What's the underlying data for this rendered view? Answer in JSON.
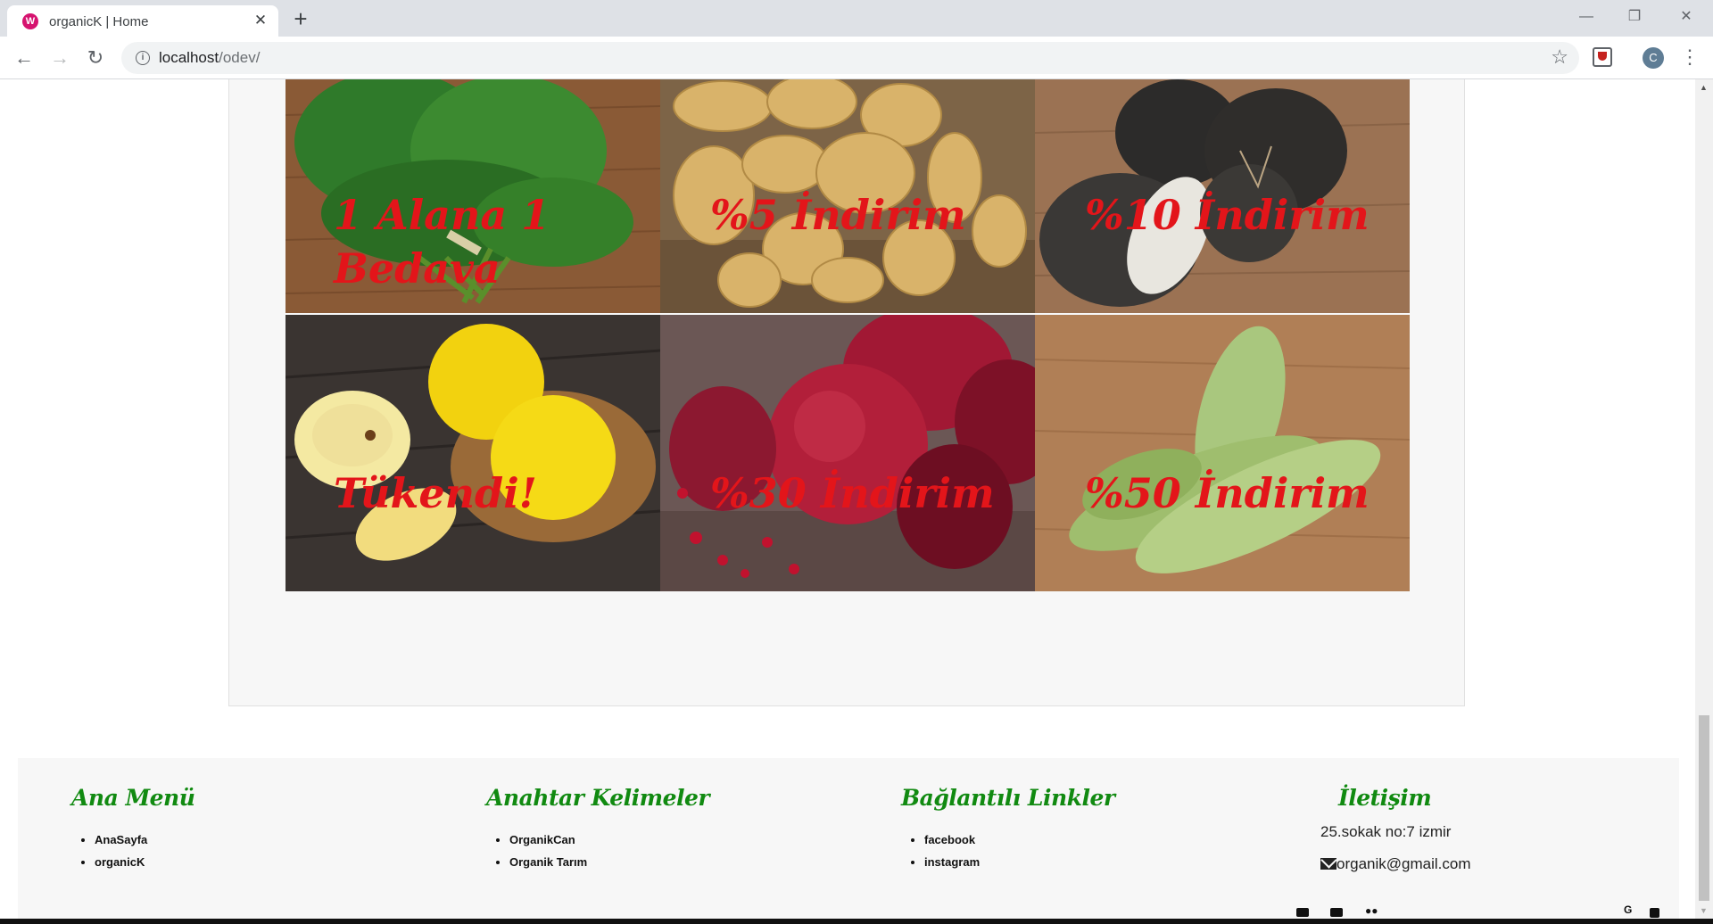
{
  "browser": {
    "tab_title": "organicK | Home",
    "tab_favicon": "wamp-icon",
    "url_host": "localhost",
    "url_path": "/odev/",
    "profile_initial": "C"
  },
  "products": [
    {
      "caption": "1 Alana 1 Bedava",
      "image": "dill"
    },
    {
      "caption": "%5 İndirim",
      "image": "potatoes"
    },
    {
      "caption": "%10 İndirim",
      "image": "black-radish"
    },
    {
      "caption": "Tükendi!",
      "image": "quince"
    },
    {
      "caption": "%30 İndirim",
      "image": "pomegranate"
    },
    {
      "caption": "%50 İndirim",
      "image": "zucchini"
    }
  ],
  "footer": {
    "menu": {
      "title": "Ana Menü",
      "items": [
        "AnaSayfa",
        "organicK"
      ]
    },
    "keywords": {
      "title": "Anahtar Kelimeler",
      "items": [
        "OrganikCan",
        "Organik Tarım"
      ]
    },
    "links": {
      "title": "Bağlantılı Linkler",
      "items": [
        "facebook",
        "instagram"
      ]
    },
    "contact": {
      "title": "İletişim",
      "address": "25.sokak no:7 izmir",
      "email": "organik@gmail.com"
    },
    "social_icons": [
      "video-icon",
      "card-icon",
      "tripadvisor-icon",
      "google-icon",
      "facebook-icon"
    ]
  },
  "colors": {
    "caption": "#e3151a",
    "footer_heading": "#118a11",
    "footer_bg": "#f7f7f7"
  }
}
